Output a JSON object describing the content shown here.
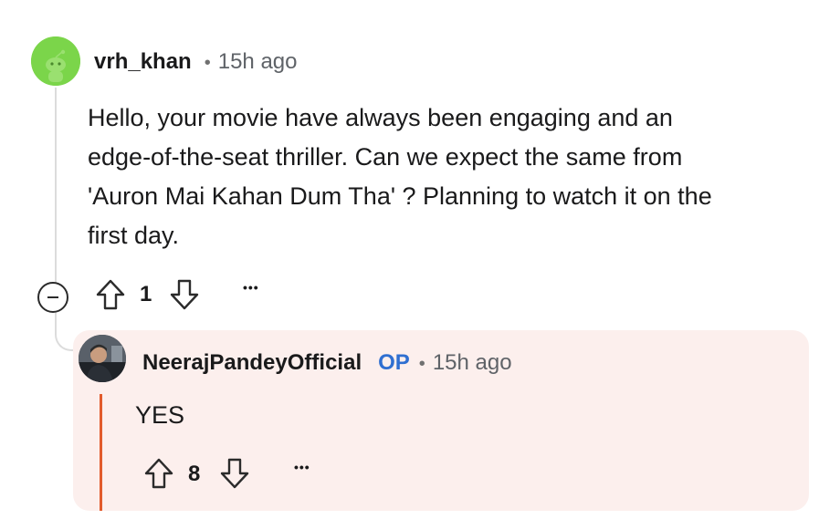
{
  "comment": {
    "username": "vrh_khan",
    "separator": "•",
    "time": "15h ago",
    "body_lines": [
      "Hello, your movie have always been engaging and an",
      "edge-of-the-seat thriller. Can we expect the same from",
      "'Auron Mai Kahan Dum Tha' ? Planning to watch it on the",
      "first day."
    ],
    "vote_count": "1",
    "more_label": "•••",
    "icons": {
      "avatar": "reddit-snoo-avatar-icon",
      "collapse": "collapse-minus-icon",
      "upvote": "upvote-arrow-icon",
      "downvote": "downvote-arrow-icon"
    },
    "avatar_color": "#7bd54a"
  },
  "reply": {
    "username": "NeerajPandeyOfficial",
    "op_label": "OP",
    "separator": "•",
    "time": "15h ago",
    "body": "YES",
    "vote_count": "8",
    "more_label": "•••",
    "icons": {
      "avatar": "user-photo-avatar",
      "upvote": "upvote-arrow-icon",
      "downvote": "downvote-arrow-icon"
    },
    "card_color": "#fcefed",
    "accent_bar_color": "#e25b2c",
    "op_color": "#2f6fd1"
  }
}
